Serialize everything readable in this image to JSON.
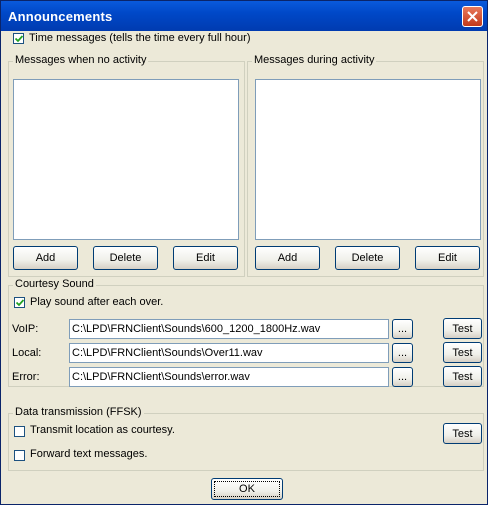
{
  "window": {
    "title": "Announcements"
  },
  "time_messages": {
    "label": "Time messages (tells the time every full hour)",
    "checked": true
  },
  "no_activity": {
    "title": "Messages when no activity",
    "add": "Add",
    "delete": "Delete",
    "edit": "Edit"
  },
  "during_activity": {
    "title": "Messages during activity",
    "add": "Add",
    "delete": "Delete",
    "edit": "Edit"
  },
  "courtesy": {
    "title": "Courtesy Sound",
    "play_label": "Play sound after each over.",
    "play_checked": true,
    "voip_label": "VoIP:",
    "voip_value": "C:\\LPD\\FRNClient\\Sounds\\600_1200_1800Hz.wav",
    "local_label": "Local:",
    "local_value": "C:\\LPD\\FRNClient\\Sounds\\Over11.wav",
    "error_label": "Error:",
    "error_value": "C:\\LPD\\FRNClient\\Sounds\\error.wav",
    "browse_label": "...",
    "test_label": "Test"
  },
  "data_tx": {
    "title": "Data transmission (FFSK)",
    "transmit_label": "Transmit location as courtesy.",
    "transmit_checked": false,
    "forward_label": "Forward text messages.",
    "forward_checked": false,
    "test_label": "Test"
  },
  "ok_label": "OK"
}
